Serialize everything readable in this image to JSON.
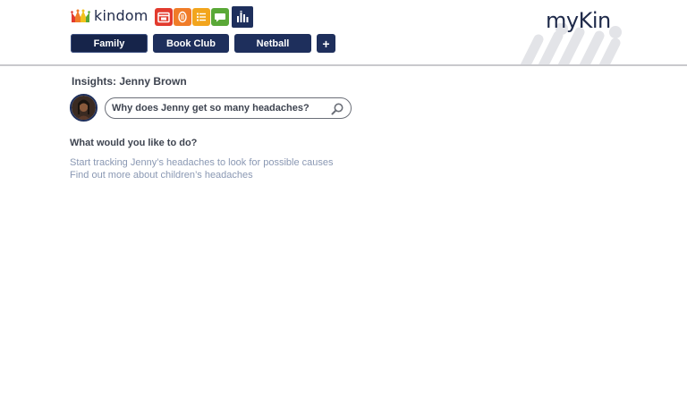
{
  "header": {
    "brand": "kindom",
    "logo": "myKin",
    "apps": [
      {
        "icon": "calendar-icon",
        "color": "#e23b2e"
      },
      {
        "icon": "badge-icon",
        "color": "#f07c28"
      },
      {
        "icon": "list-icon",
        "color": "#f2a51d"
      },
      {
        "icon": "chat-icon",
        "color": "#5aa837"
      },
      {
        "icon": "insights-chart-icon",
        "color": "#1e2f5c"
      }
    ],
    "tabs": [
      {
        "label": "Family"
      },
      {
        "label": "Book Club"
      },
      {
        "label": "Netball"
      }
    ],
    "add_label": "+"
  },
  "insights": {
    "title": "Insights: Jenny Brown",
    "search_value": "Why does Jenny get so many headaches?"
  },
  "prompt": "What would you like to do?",
  "actions": [
    {
      "label": "Start tracking Jenny’s headaches to look for possible causes"
    },
    {
      "label": "Find out more about children’s headaches"
    }
  ],
  "colors": {
    "navy": "#1e2f5c",
    "link": "#8a98b3",
    "text": "#3e4450"
  }
}
